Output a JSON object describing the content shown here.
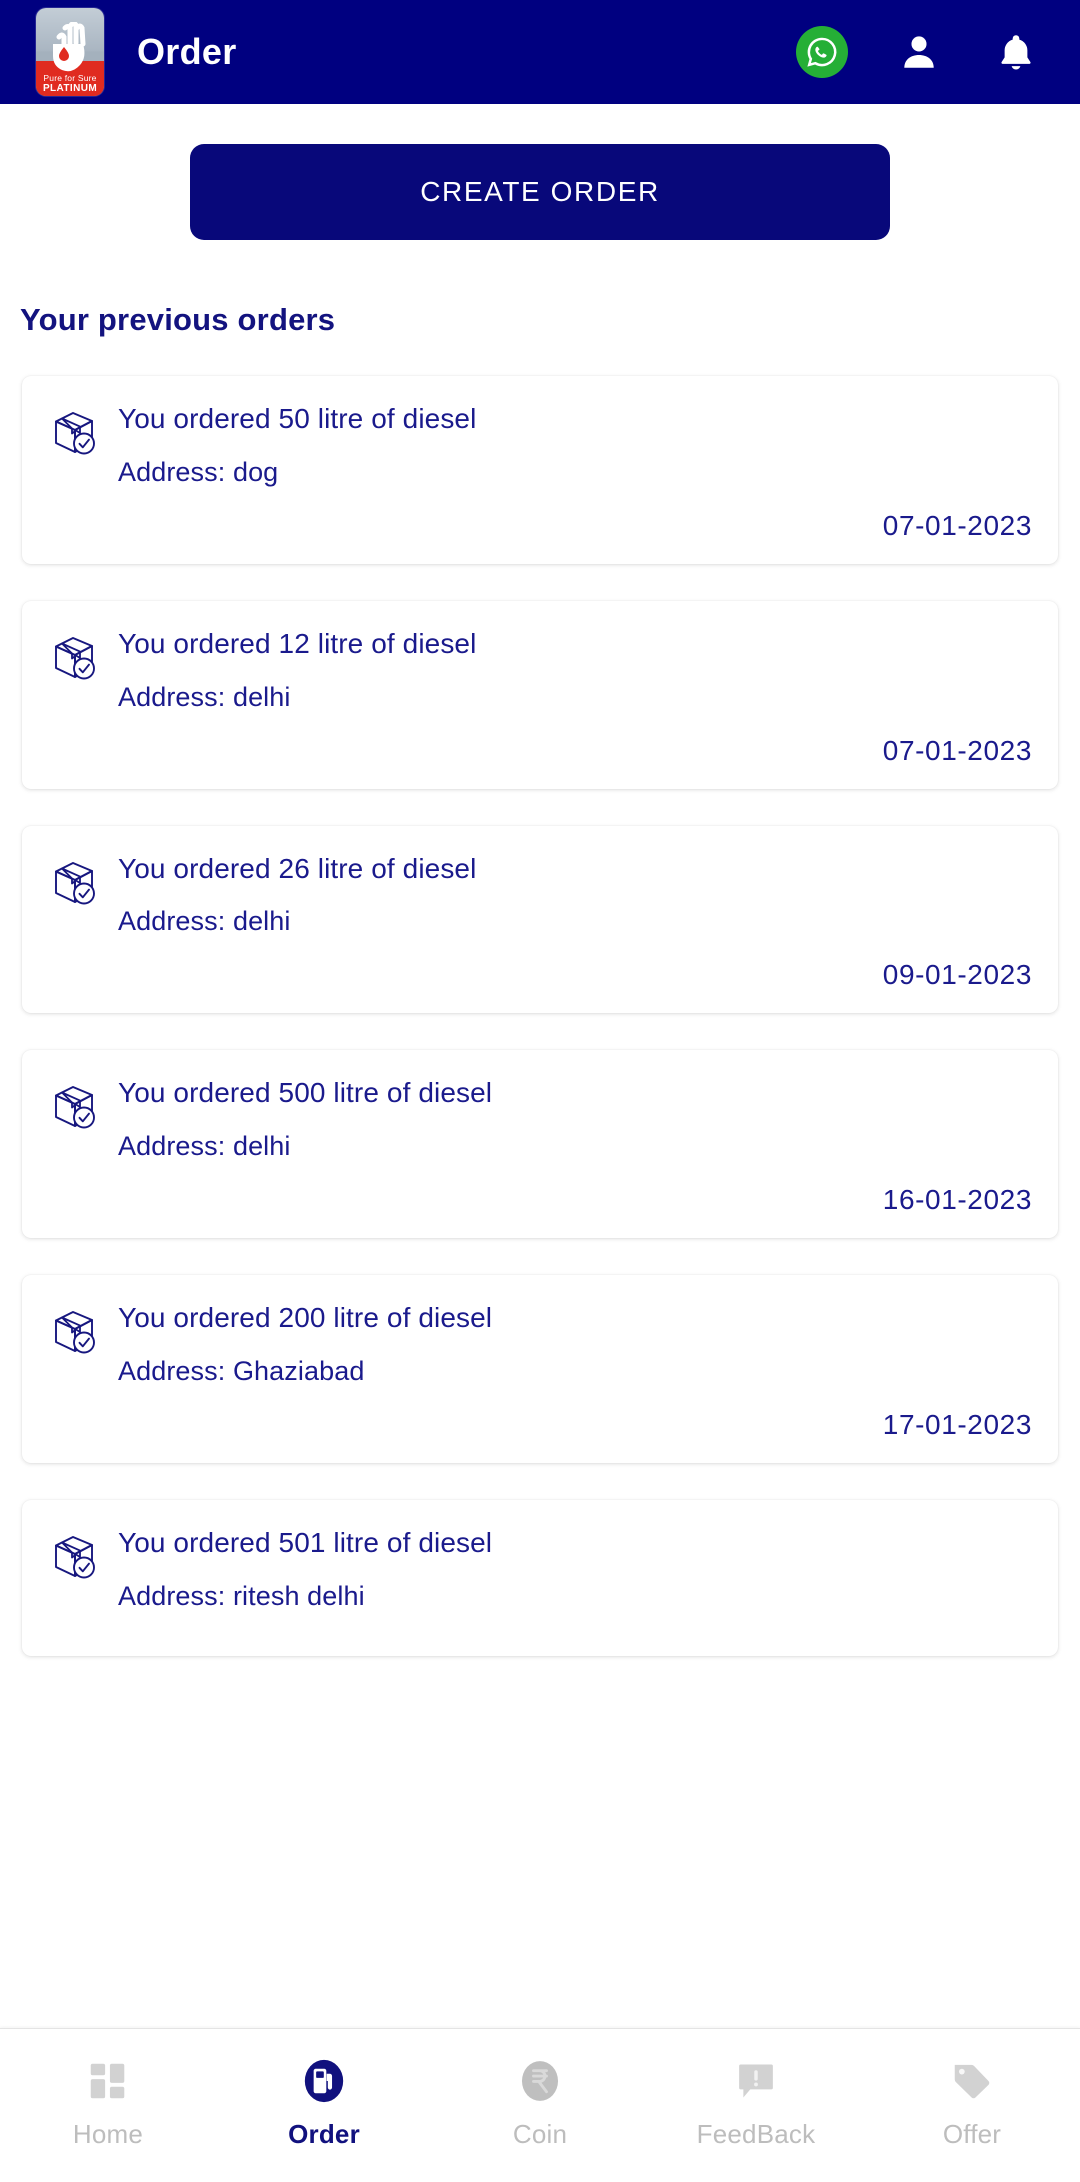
{
  "header": {
    "title": "Order",
    "logo": {
      "line1": "Pure for Sure",
      "line2": "PLATINUM",
      "name": "pure-for-sure-platinum-logo"
    },
    "actions": [
      {
        "name": "whatsapp-icon",
        "label": "WhatsApp"
      },
      {
        "name": "profile-icon",
        "label": "Profile"
      },
      {
        "name": "notification-bell-icon",
        "label": "Notifications"
      }
    ],
    "background_color": "#000080"
  },
  "main": {
    "create_order_label": "CREATE ORDER",
    "section_title": "Your previous orders",
    "accent_color": "#08087a",
    "text_color": "#1a1a8c",
    "orders": [
      {
        "title": "You ordered 50 litre of diesel",
        "address": "Address: dog",
        "date": "07-01-2023"
      },
      {
        "title": "You ordered 12 litre of diesel",
        "address": "Address: delhi",
        "date": "07-01-2023"
      },
      {
        "title": "You ordered 26 litre of diesel",
        "address": "Address: delhi",
        "date": "09-01-2023"
      },
      {
        "title": "You ordered 500 litre of diesel",
        "address": "Address: delhi",
        "date": "16-01-2023"
      },
      {
        "title": "You ordered 200 litre of diesel",
        "address": "Address: Ghaziabad",
        "date": "17-01-2023"
      },
      {
        "title": "You ordered 501 litre of diesel",
        "address": "Address: ritesh delhi",
        "date": ""
      }
    ]
  },
  "bottom_nav": {
    "active_index": 1,
    "active_color": "#11117e",
    "inactive_color": "#bdbdbd",
    "items": [
      {
        "label": "Home",
        "icon": "grid-dashboard-icon"
      },
      {
        "label": "Order",
        "icon": "fuel-pump-icon"
      },
      {
        "label": "Coin",
        "icon": "rupee-coin-icon"
      },
      {
        "label": "FeedBack",
        "icon": "speech-bubble-alert-icon"
      },
      {
        "label": "Offer",
        "icon": "price-tag-icon"
      }
    ]
  }
}
